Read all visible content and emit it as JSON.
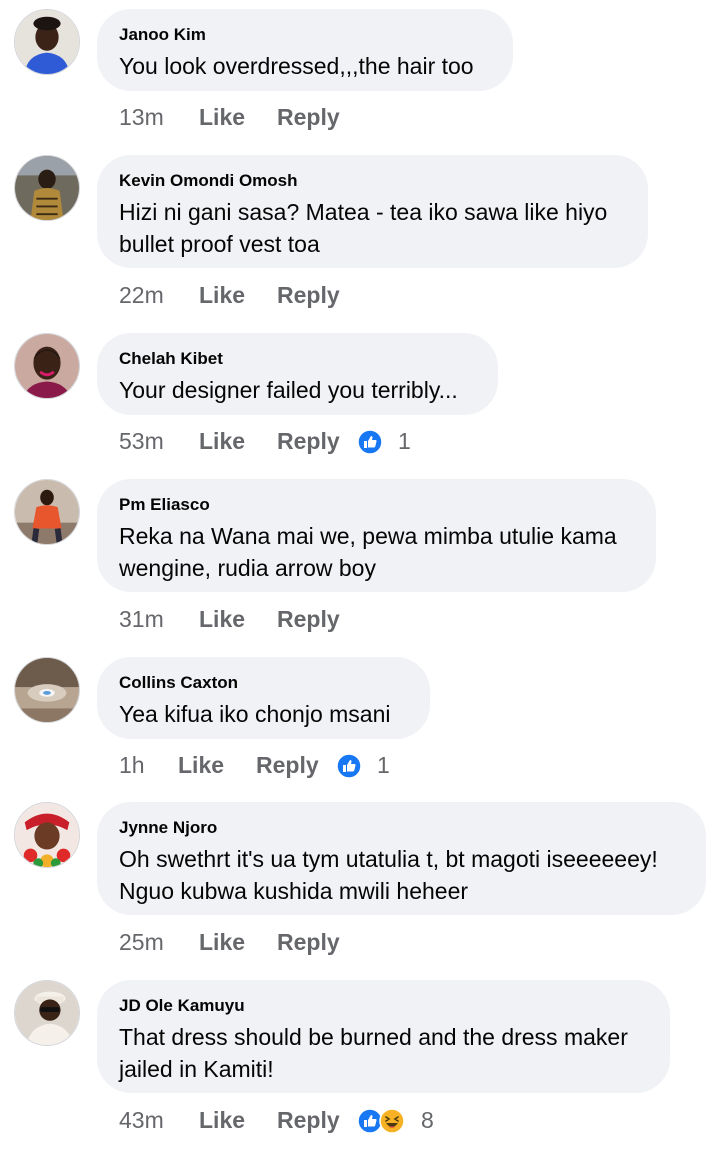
{
  "comments": [
    {
      "author": "Janoo Kim",
      "text": "You look overdressed,,,the hair too",
      "time": "13m",
      "like": "Like",
      "reply": "Reply",
      "reactions": null
    },
    {
      "author": "Kevin Omondi Omosh",
      "text": "Hizi ni gani sasa? Matea - tea iko sawa like hiyo bullet proof vest toa",
      "time": "22m",
      "like": "Like",
      "reply": "Reply",
      "reactions": null
    },
    {
      "author": "Chelah Kibet",
      "text": "Your designer failed you terribly...",
      "time": "53m",
      "like": "Like",
      "reply": "Reply",
      "reactions": {
        "count": "1",
        "icons": [
          "like-reaction-icon"
        ]
      }
    },
    {
      "author": "Pm Eliasco",
      "text": "Reka na Wana mai we, pewa mimba utulie kama wengine, rudia arrow boy",
      "time": "31m",
      "like": "Like",
      "reply": "Reply",
      "reactions": null
    },
    {
      "author": "Collins Caxton",
      "text": "Yea kifua iko chonjo msani",
      "time": "1h",
      "like": "Like",
      "reply": "Reply",
      "reactions": {
        "count": "1",
        "icons": [
          "like-reaction-icon"
        ]
      }
    },
    {
      "author": "Jynne Njoro",
      "text": "Oh swethrt it's ua tym utatulia t, bt magoti iseeeeeey! Nguo kubwa kushida mwili heheer",
      "time": "25m",
      "like": "Like",
      "reply": "Reply",
      "reactions": null
    },
    {
      "author": "JD Ole Kamuyu",
      "text": "That dress should be burned and the dress maker jailed in Kamiti!",
      "time": "43m",
      "like": "Like",
      "reply": "Reply",
      "reactions": {
        "count": "8",
        "icons": [
          "like-reaction-icon",
          "haha-reaction-icon"
        ]
      }
    }
  ],
  "colors": {
    "bubble": "#f0f2f5",
    "text": "#050505",
    "meta": "#65676b",
    "like_blue": "#1877f2",
    "haha_yellow": "#f7b125"
  }
}
